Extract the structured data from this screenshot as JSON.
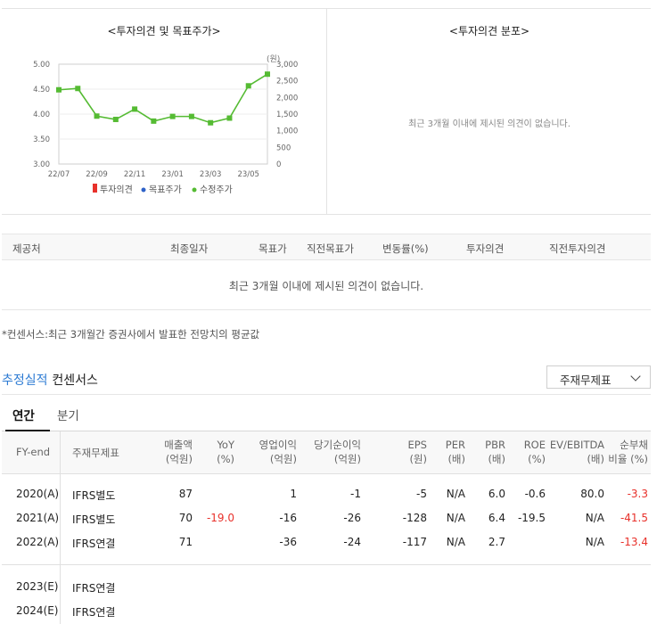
{
  "opinion_panel": {
    "title": "<투자의견 및 목표주가>",
    "unit": "(원)",
    "legend": [
      "투자의견",
      "목표주가",
      "수정주가"
    ],
    "legend_colors": [
      "#e8312b",
      "#2e62c8",
      "#55bb33"
    ]
  },
  "chart_data": {
    "type": "line",
    "x": [
      "22/07",
      "22/08",
      "22/09",
      "22/10",
      "22/11",
      "22/12",
      "23/01",
      "23/02",
      "23/03",
      "23/04",
      "23/05",
      "23/06"
    ],
    "x_ticks": [
      "22/07",
      "22/09",
      "22/11",
      "23/01",
      "23/03",
      "23/05"
    ],
    "left_ticks": [
      "5.00",
      "4.50",
      "4.00",
      "3.50",
      "3.00"
    ],
    "right_ticks": [
      "3,000",
      "2,500",
      "2,000",
      "1,500",
      "1,000",
      "500",
      "0"
    ],
    "ylim_left": [
      3.0,
      5.0
    ],
    "ylim_right": [
      0,
      3000
    ],
    "series": [
      {
        "name": "수정주가",
        "color": "#55bb33",
        "values": [
          2230,
          2270,
          1440,
          1340,
          1650,
          1290,
          1430,
          1430,
          1240,
          1380,
          2350,
          2700
        ]
      }
    ]
  },
  "dist_panel": {
    "title": "<투자의견 분포>",
    "empty_msg": "최근 3개월 이내에 제시된 의견이 없습니다."
  },
  "opinion_table": {
    "headers": [
      "제공처",
      "최종일자",
      "목표가",
      "직전목표가",
      "변동률(%)",
      "투자의견",
      "직전투자의견"
    ],
    "empty_msg": "최근 3개월 이내에 제시된 의견이 없습니다."
  },
  "footnote": "*컨센서스:최근 3개월간 증권사에서 발표한 전망치의 평균값",
  "section": {
    "title_blue": "추정실적",
    "title_rest": "컨센서스"
  },
  "select": {
    "value": "주재무제표"
  },
  "tabs": [
    "연간",
    "분기"
  ],
  "fin_table": {
    "headers": [
      [
        "FY-end"
      ],
      [
        "주재무제표"
      ],
      [
        "매출액",
        "(억원)"
      ],
      [
        "YoY",
        "(%)"
      ],
      [
        "영업이익",
        "(억원)"
      ],
      [
        "당기순이익",
        "(억원)"
      ],
      [
        "EPS",
        "(원)"
      ],
      [
        "PER",
        "(배)"
      ],
      [
        "PBR",
        "(배)"
      ],
      [
        "ROE",
        "(%)"
      ],
      [
        "EV/EBITDA",
        "(배)"
      ],
      [
        "순부채",
        "비율 (%)"
      ]
    ],
    "rows": [
      [
        "2020(A)",
        "IFRS별도",
        "87",
        "",
        "1",
        "-1",
        "-5",
        "N/A",
        "6.0",
        "-0.6",
        "80.0",
        "-3.3"
      ],
      [
        "2021(A)",
        "IFRS별도",
        "70",
        "-19.0",
        "-16",
        "-26",
        "-128",
        "N/A",
        "6.4",
        "-19.5",
        "N/A",
        "-41.5"
      ],
      [
        "2022(A)",
        "IFRS연결",
        "71",
        "",
        "-36",
        "-24",
        "-117",
        "N/A",
        "2.7",
        "",
        "N/A",
        "-13.4"
      ],
      [
        "2023(E)",
        "IFRS연결",
        "",
        "",
        "",
        "",
        "",
        "",
        "",
        "",
        "",
        ""
      ],
      [
        "2024(E)",
        "IFRS연결",
        "",
        "",
        "",
        "",
        "",
        "",
        "",
        "",
        "",
        ""
      ]
    ]
  }
}
